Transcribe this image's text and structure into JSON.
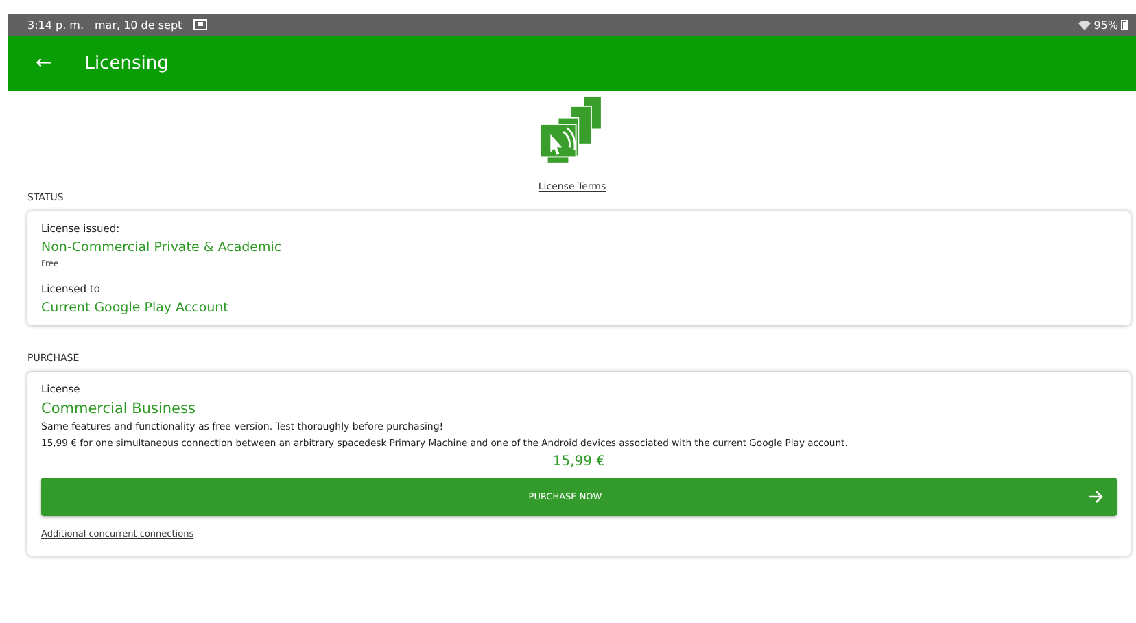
{
  "status_bar": {
    "time": "3:14 p. m.",
    "date": "mar, 10 de sept",
    "battery": "95%"
  },
  "app_bar": {
    "title": "Licensing",
    "back_icon": "←"
  },
  "license_terms": "License Terms",
  "status": {
    "heading": "STATUS",
    "items": [
      {
        "label": "License issued:",
        "value": "Non-Commercial Private & Academic",
        "note": "Free"
      },
      {
        "label": "Licensed to",
        "value": "Current Google Play Account"
      }
    ]
  },
  "purchase": {
    "heading": "PURCHASE",
    "label": "License",
    "title": "Commercial Business",
    "description": "Same features and functionality as free version. Test thoroughly before purchasing!",
    "details": "15,99 € for one simultaneous connection between an arbitrary spacedesk Primary Machine and one of the Android devices associated with the current Google Play account.",
    "price": "15,99 €",
    "button": "PURCHASE NOW",
    "link": "Additional concurrent connections"
  }
}
